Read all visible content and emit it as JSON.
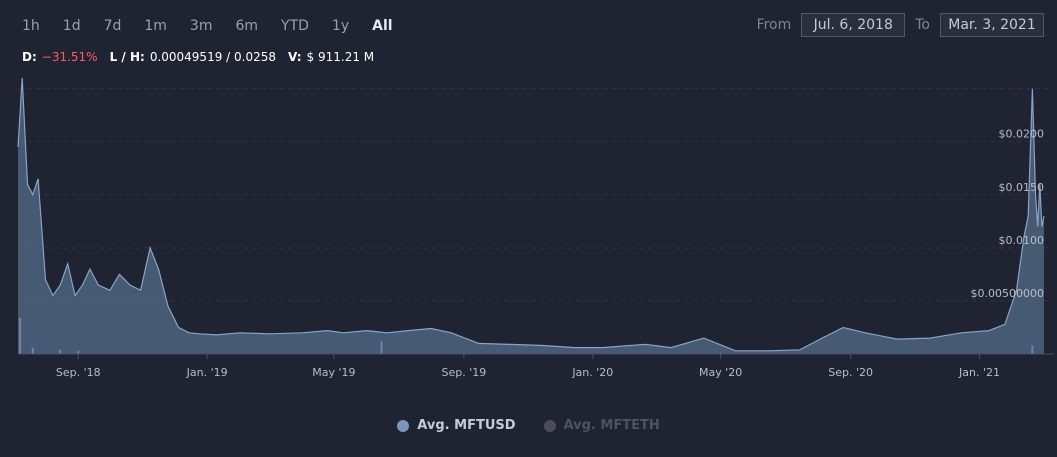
{
  "range_buttons": [
    "1h",
    "1d",
    "7d",
    "1m",
    "3m",
    "6m",
    "YTD",
    "1y",
    "All"
  ],
  "active_range": "All",
  "date_range": {
    "from_label": "From",
    "from_value": "Jul. 6, 2018",
    "to_label": "To",
    "to_value": "Mar. 3, 2021"
  },
  "stats": {
    "d_label": "D:",
    "d_value": "−31.51%",
    "lh_label": "L / H:",
    "lh_value": "0.00049519 / 0.0258",
    "v_label": "V:",
    "v_value": "$ 911.21 M"
  },
  "legend": [
    {
      "label": "Avg. MFTUSD",
      "color": "#7c95b8",
      "active": true
    },
    {
      "label": "Avg. MFTETH",
      "color": "#4a4d56",
      "active": false
    }
  ],
  "colors": {
    "background": "#1f2332",
    "series_line": "#8aa3c4",
    "series_fill": "#4f6480",
    "volume": "#6f86a6",
    "gridline": "#2e3344"
  },
  "chart_data": {
    "type": "area",
    "title": "",
    "xlabel": "",
    "ylabel": "",
    "x_ticks": [
      "Sep. '18",
      "Jan. '19",
      "May '19",
      "Sep. '19",
      "Jan. '20",
      "May '20",
      "Sep. '20",
      "Jan. '21"
    ],
    "y_ticks": [
      "$0.00500000",
      "$0.0100",
      "$0.0150",
      "$0.0200"
    ],
    "ylim": [
      0,
      0.026
    ],
    "grid": true,
    "series": [
      {
        "name": "Avg. MFTUSD",
        "x": [
          "2018-07-06",
          "2018-07-10",
          "2018-07-15",
          "2018-07-20",
          "2018-07-25",
          "2018-08-01",
          "2018-08-08",
          "2018-08-15",
          "2018-08-22",
          "2018-08-29",
          "2018-09-05",
          "2018-09-12",
          "2018-09-20",
          "2018-10-01",
          "2018-10-10",
          "2018-10-20",
          "2018-10-30",
          "2018-11-08",
          "2018-11-16",
          "2018-11-25",
          "2018-12-05",
          "2018-12-15",
          "2018-12-25",
          "2019-01-10",
          "2019-02-01",
          "2019-03-01",
          "2019-04-01",
          "2019-04-25",
          "2019-05-10",
          "2019-06-01",
          "2019-06-20",
          "2019-07-10",
          "2019-08-01",
          "2019-08-20",
          "2019-09-15",
          "2019-10-15",
          "2019-11-15",
          "2019-12-15",
          "2020-01-10",
          "2020-02-05",
          "2020-02-20",
          "2020-03-15",
          "2020-04-15",
          "2020-05-15",
          "2020-06-15",
          "2020-07-15",
          "2020-08-05",
          "2020-08-25",
          "2020-09-15",
          "2020-10-15",
          "2020-11-15",
          "2020-12-15",
          "2021-01-10",
          "2021-01-25",
          "2021-02-05",
          "2021-02-12",
          "2021-02-16",
          "2021-02-20",
          "2021-02-23",
          "2021-02-25",
          "2021-02-27",
          "2021-03-01",
          "2021-03-03"
        ],
        "y": [
          0.0195,
          0.026,
          0.016,
          0.015,
          0.0165,
          0.007,
          0.0055,
          0.0065,
          0.0085,
          0.0055,
          0.0065,
          0.008,
          0.0065,
          0.006,
          0.0075,
          0.0065,
          0.006,
          0.01,
          0.008,
          0.0045,
          0.0025,
          0.002,
          0.0019,
          0.0018,
          0.002,
          0.0019,
          0.002,
          0.0022,
          0.002,
          0.0022,
          0.002,
          0.0022,
          0.0024,
          0.002,
          0.001,
          0.0009,
          0.0008,
          0.0006,
          0.0006,
          0.0008,
          0.0009,
          0.0006,
          0.0015,
          0.0003,
          0.0003,
          0.0004,
          0.0015,
          0.0025,
          0.002,
          0.0014,
          0.0015,
          0.002,
          0.0022,
          0.0028,
          0.006,
          0.011,
          0.013,
          0.025,
          0.015,
          0.012,
          0.016,
          0.012,
          0.013
        ]
      }
    ],
    "volume_series": {
      "x": [
        "2018-07-08",
        "2018-07-20",
        "2018-08-15",
        "2018-09-01",
        "2019-06-15",
        "2020-05-01",
        "2021-02-20"
      ],
      "y": [
        0.0034,
        0.0006,
        0.0004,
        0.0003,
        0.0012,
        0.0001,
        0.0008
      ]
    }
  }
}
